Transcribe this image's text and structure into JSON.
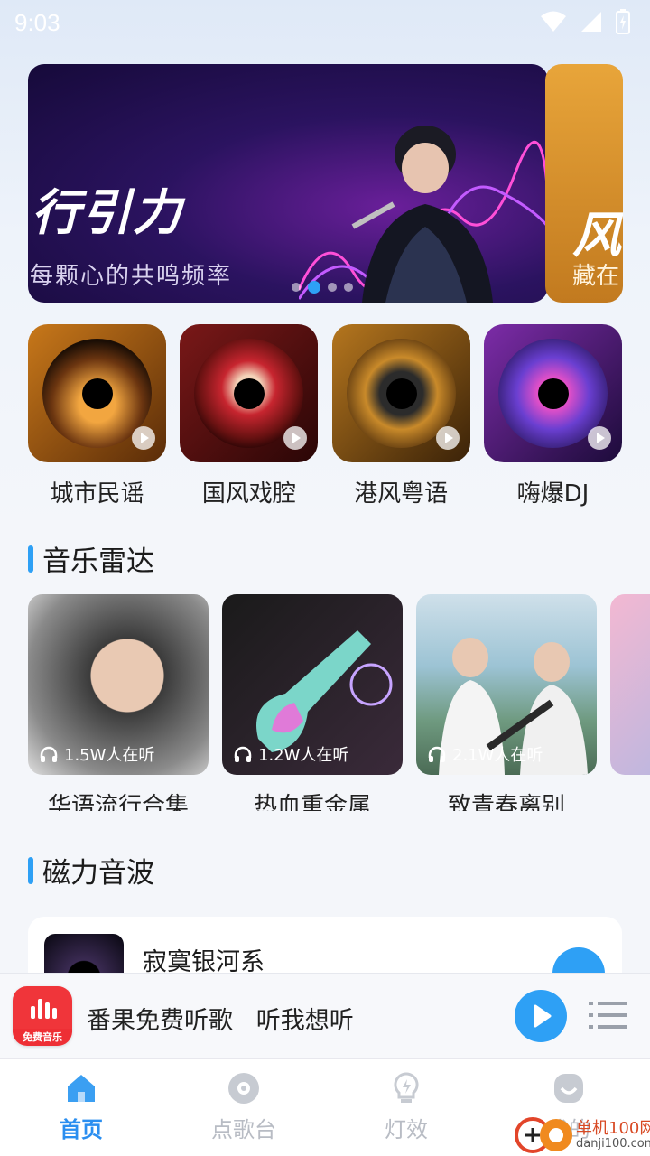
{
  "status_bar": {
    "time": "9:03"
  },
  "banner": {
    "title": "行引力",
    "subtitle": "每颗心的共鸣频率",
    "next_title": "风",
    "next_subtitle": "藏在",
    "dots": 4,
    "active_dot": 2
  },
  "categories": [
    {
      "label": "城市民谣"
    },
    {
      "label": "国风戏腔"
    },
    {
      "label": "港风粤语"
    },
    {
      "label": "嗨爆DJ"
    }
  ],
  "radar": {
    "title": "音乐雷达",
    "items": [
      {
        "name": "华语流行合集",
        "listeners": "1.5W人在听"
      },
      {
        "name": "热血重金属",
        "listeners": "1.2W人在听"
      },
      {
        "name": "致青春离别",
        "listeners": "2.1W人在听"
      }
    ]
  },
  "magnet": {
    "title": "磁力音波",
    "song": {
      "title": "寂寞银河系"
    }
  },
  "player": {
    "text": "番果免费听歌   听我想听",
    "logo_text": "免费音乐"
  },
  "nav": {
    "items": [
      {
        "label": "首页",
        "icon": "home-icon"
      },
      {
        "label": "点歌台",
        "icon": "disc-icon"
      },
      {
        "label": "灯效",
        "icon": "bulb-icon"
      },
      {
        "label": "我的",
        "icon": "profile-icon"
      }
    ]
  },
  "watermark": {
    "text": "单机100网",
    "sub": "danji100.com"
  },
  "colors": {
    "accent": "#2ea0f5",
    "nav_active": "#2a8ef0"
  }
}
